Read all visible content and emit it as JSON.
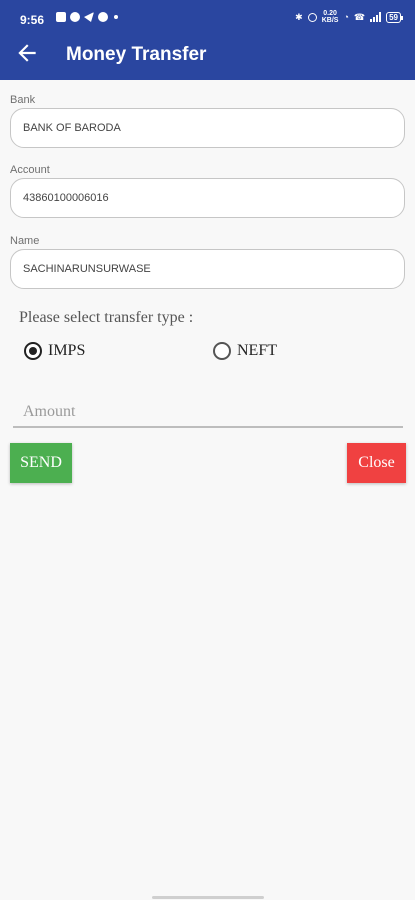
{
  "status_bar": {
    "time": "9:56",
    "network_speed_value": "0.20",
    "network_speed_unit": "KB/S",
    "battery": "59"
  },
  "header": {
    "title": "Money Transfer"
  },
  "form": {
    "bank": {
      "label": "Bank",
      "value": "BANK OF BARODA"
    },
    "account": {
      "label": "Account",
      "value": "43860100006016"
    },
    "name": {
      "label": "Name",
      "value": "SACHINARUNSURWASE"
    },
    "transfer_prompt": "Please select transfer type :",
    "transfer_options": [
      {
        "label": "IMPS",
        "selected": true
      },
      {
        "label": "NEFT",
        "selected": false
      }
    ],
    "amount": {
      "placeholder": "Amount",
      "value": ""
    }
  },
  "actions": {
    "send_label": "SEND",
    "close_label": "Close"
  },
  "colors": {
    "app_bar": "#2a46a0",
    "send_button": "#4caf50",
    "close_button": "#f04141"
  }
}
